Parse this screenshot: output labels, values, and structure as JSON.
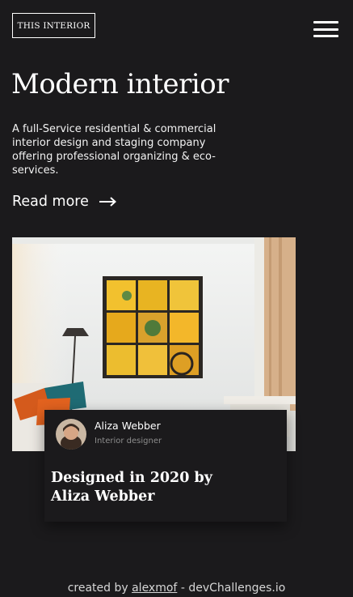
{
  "header": {
    "logo_text": "THIS INTERIOR",
    "menu_icon": "hamburger-icon"
  },
  "hero": {
    "title": "Modern interior",
    "description": "A full-Service residential & commercial interior design and staging company offering professional organizing & eco-services.",
    "read_more_label": "Read more",
    "read_more_icon": "arrow-right-icon"
  },
  "feature": {
    "image_icon": "interior-room-photo",
    "author_name": "Aliza Webber",
    "author_role": "Interior designer",
    "card_title": "Designed in 2020 by Aliza Webber"
  },
  "footer": {
    "prefix": "created by",
    "author_link": "alexmof",
    "suffix": "- devChallenges.io"
  },
  "colors": {
    "background": "#1b1a1c",
    "text": "#ffffff",
    "muted": "#8d8d8d"
  }
}
